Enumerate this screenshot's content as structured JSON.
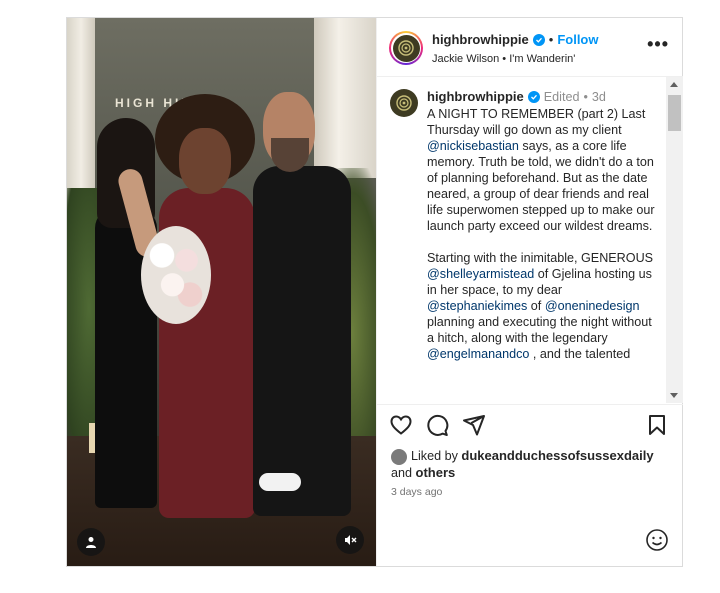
{
  "media": {
    "sign_text": "HIGH    HIPPIE",
    "user_tag_icon": "person-icon",
    "mute_icon": "speaker-muted-icon"
  },
  "header": {
    "username": "highbrowhippie",
    "separator": "•",
    "follow_label": "Follow",
    "subtitle": "Jackie Wilson • I'm Wanderin'",
    "more_icon": "more-horizontal-icon",
    "more_label": "•••"
  },
  "caption": {
    "username": "highbrowhippie",
    "edited": "Edited",
    "separator": "•",
    "age": "3d",
    "p1_a": "A NIGHT TO REMEMBER (part 2) Last Thursday will go down as my client ",
    "p1_link": "@nickisebastian",
    "p1_b": " says, as a core life memory. Truth be told, we didn't do a ton of planning beforehand. But as the date neared, a group of dear friends and real life superwomen stepped up to make our launch party exceed our wildest dreams.",
    "p2_a": "Starting with the inimitable, GENEROUS ",
    "p2_link1": "@shelleyarmistead",
    "p2_b": " of Gjelina hosting us in her space, to my dear ",
    "p2_link2": "@stephaniekimes",
    "p2_c": " of ",
    "p2_link3": "@oneninedesign",
    "p2_d": " planning and executing the night without a hitch, along with the legendary ",
    "p2_link4": "@engelmanandco",
    "p2_e": " , and the talented"
  },
  "likes": {
    "prefix": "Liked by ",
    "user": "dukeandduchessofsussexdaily",
    "and": " and ",
    "others": "others"
  },
  "timestamp": "3 days ago",
  "colors": {
    "link": "#00376b",
    "follow": "#0095f6",
    "verified": "#0095f6"
  }
}
